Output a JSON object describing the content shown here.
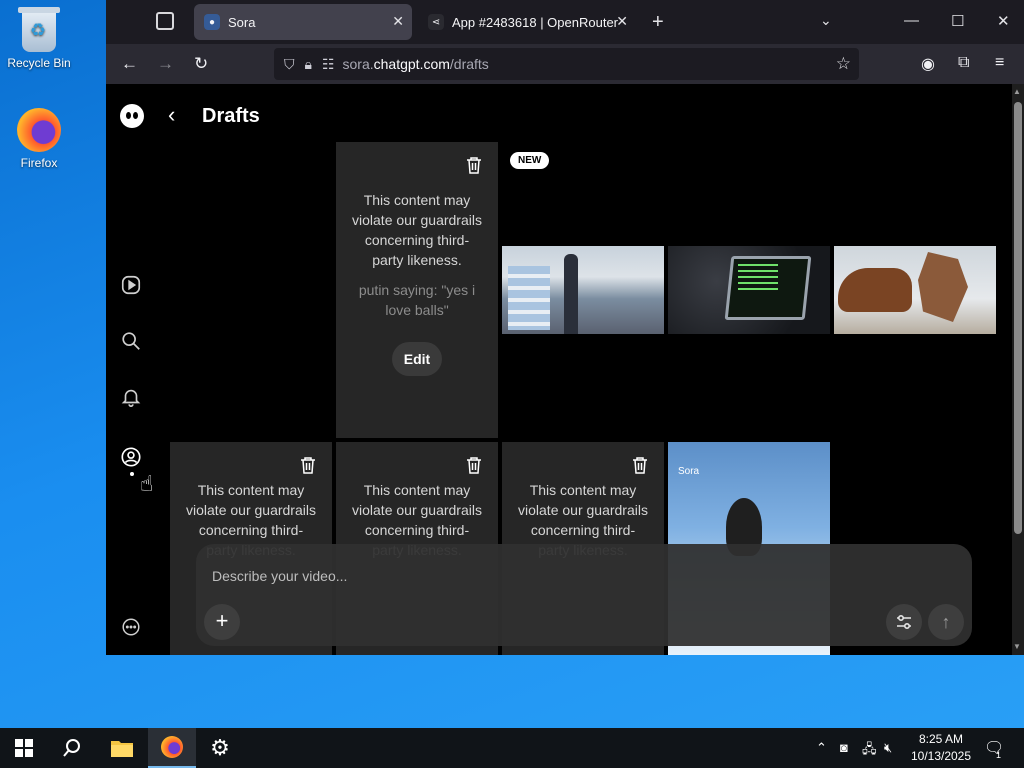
{
  "desktop": {
    "icons": [
      {
        "label": "Recycle Bin"
      },
      {
        "label": "Firefox"
      }
    ]
  },
  "browser": {
    "tabs": [
      {
        "title": "Sora",
        "active": true
      },
      {
        "title": "App #2483618 | OpenRouter",
        "active": false
      }
    ],
    "url_prefix": "sora.",
    "url_domain": "chatgpt.com",
    "url_path": "/drafts"
  },
  "page": {
    "title": "Drafts",
    "new_badge": "NEW",
    "cards": [
      {
        "message": "This content may violate our guardrails concerning third-party likeness.",
        "prompt": "putin saying: \"yes i love balls\"",
        "edit_label": "Edit"
      },
      {
        "message": "This content may violate our guardrails concerning third-party likeness."
      },
      {
        "message": "This content may violate our guardrails concerning third-party likeness."
      },
      {
        "message": "This content may violate our guardrails concerning third-party likeness."
      }
    ],
    "watermark": "Sora",
    "composer": {
      "placeholder": "Describe your video..."
    }
  },
  "taskbar": {
    "time": "8:25 AM",
    "date": "10/13/2025",
    "notifications": "1"
  }
}
